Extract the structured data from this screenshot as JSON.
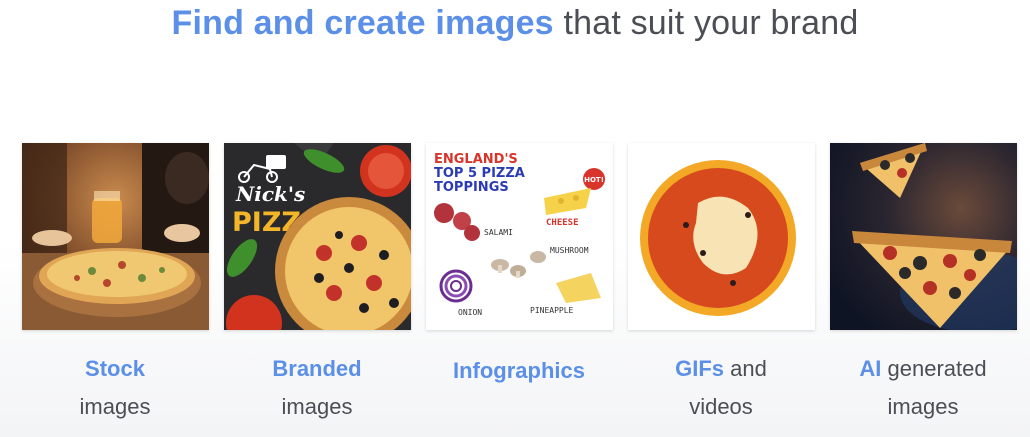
{
  "headline": {
    "highlight": "Find and create images",
    "rest": "that suit your brand"
  },
  "cards": [
    {
      "caption_bold": "Stock",
      "caption_rest": "images"
    },
    {
      "caption_bold": "Branded",
      "caption_rest": "images",
      "logo_line1": "Nick's",
      "logo_line2": "PIZZA"
    },
    {
      "caption_bold": "Infographics",
      "caption_rest": "",
      "info_title": [
        "ENGLAND'S",
        "TOP 5 PIZZA",
        "TOPPINGS"
      ],
      "toppings": [
        "SALAMI",
        "MUSHROOM",
        "ONION",
        "PINEAPPLE",
        "CHEESE"
      ],
      "badge": "HOT!"
    },
    {
      "caption_bold": "GIFs",
      "caption_rest": " and",
      "caption_line2": "videos"
    },
    {
      "caption_bold": "AI",
      "caption_rest": " generated",
      "caption_line2": "images"
    }
  ]
}
